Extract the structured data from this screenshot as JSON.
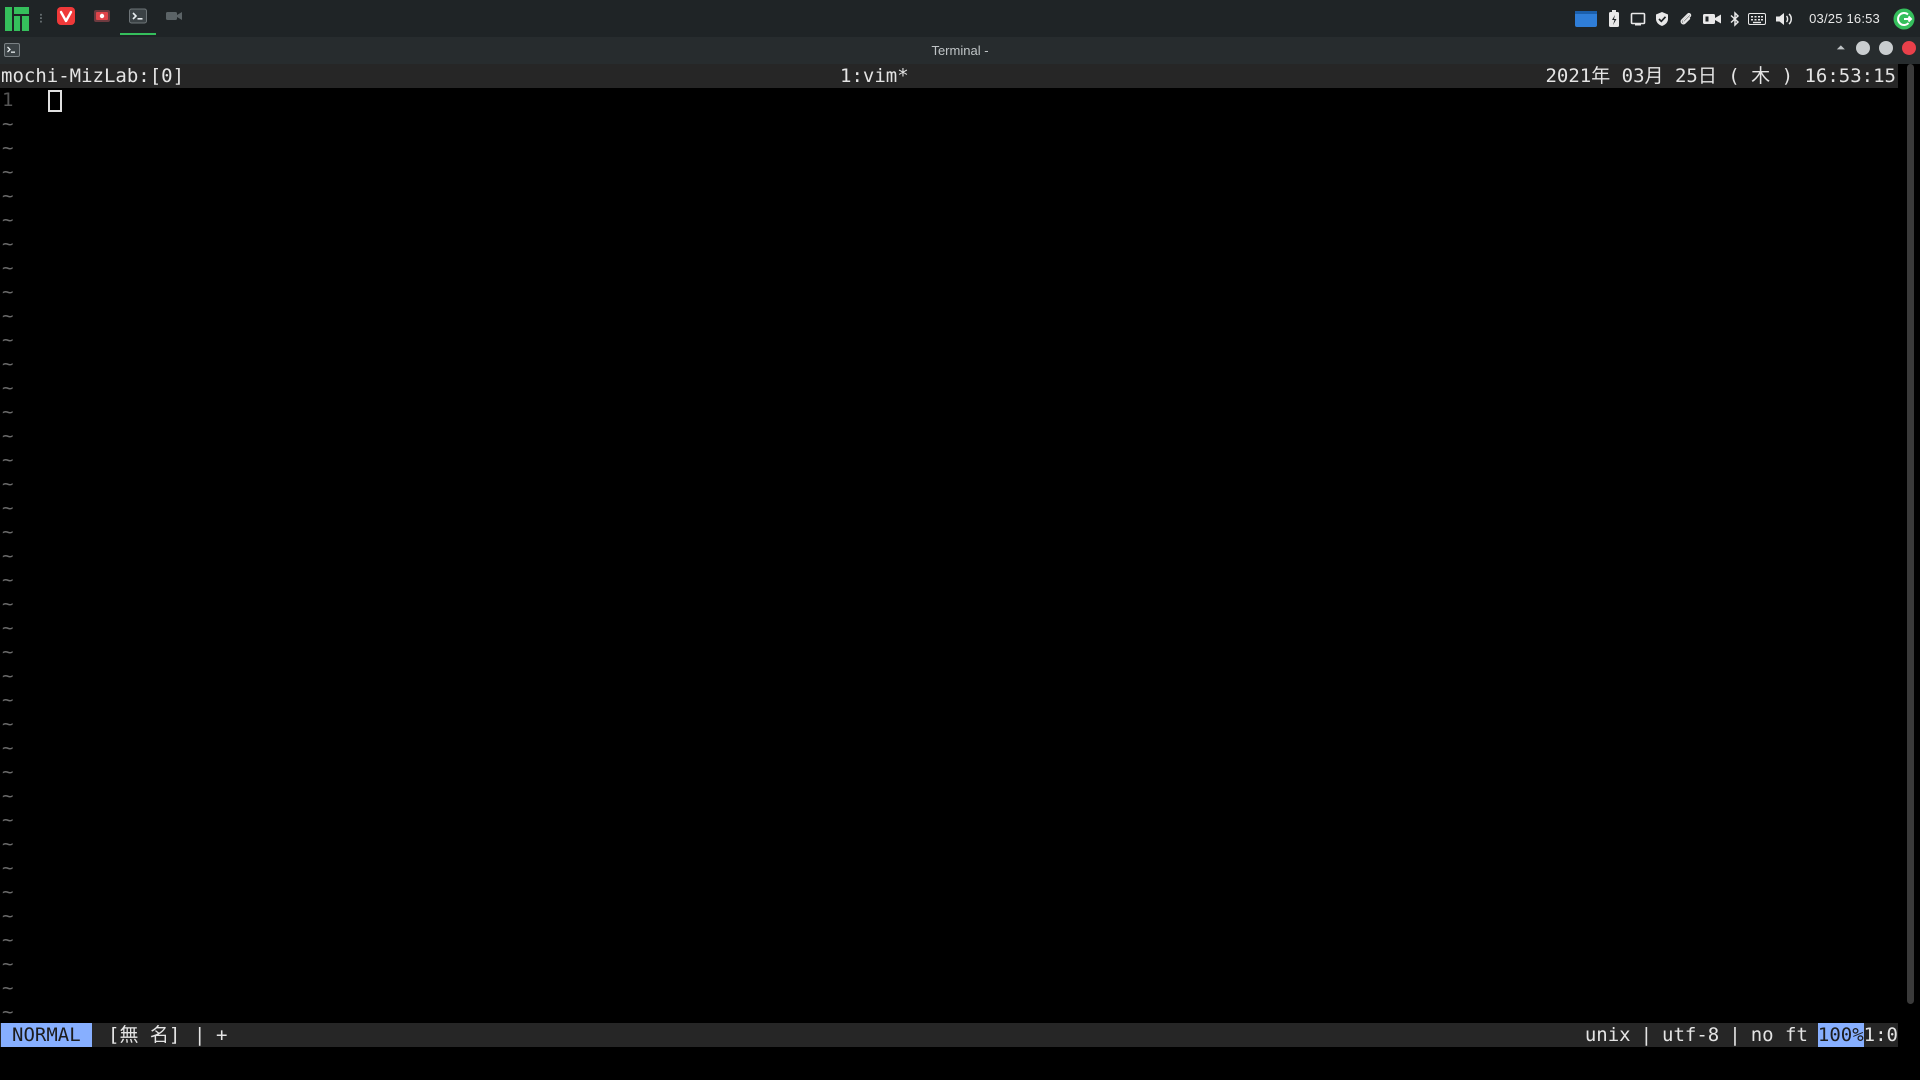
{
  "panel": {
    "clock": "03/25 16:53",
    "tasks": [
      {
        "name": "vivaldi",
        "color": "#ef3939"
      },
      {
        "name": "screen-recorder",
        "color": "#e0444a"
      },
      {
        "name": "terminal",
        "color": "#c9d1d3"
      },
      {
        "name": "video-camera",
        "color": "#5b6366"
      }
    ],
    "accent": "#35bf5c"
  },
  "window": {
    "title": "Terminal -"
  },
  "tmux": {
    "session": "mochi-MizLab:[0]",
    "window": "1:vim*",
    "datetime": "2021年 03月 25日 ( 木 ) 16:53:15"
  },
  "vim": {
    "first_line_number": "1",
    "tilde": "~",
    "mode": "NORMAL",
    "filename": "[無 名]",
    "separator": "|",
    "modified": "+",
    "fileformat": "unix",
    "encoding": "utf-8",
    "filetype": "no ft",
    "percent": "100%",
    "position": "1:0",
    "status_accent": "#87afff"
  }
}
